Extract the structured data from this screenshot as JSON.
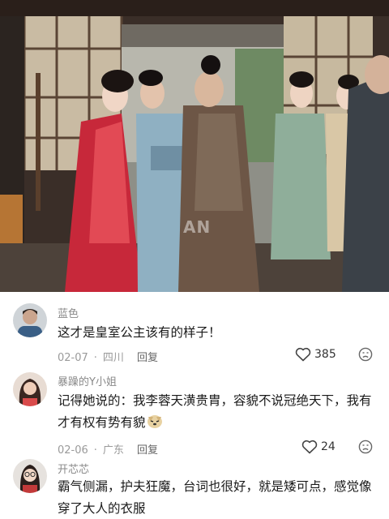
{
  "watermark": "AN",
  "comments": [
    {
      "user": "蓝色",
      "text": "这才是皇室公主该有的样子！",
      "date": "02-07",
      "location": "四川",
      "reply_label": "回复",
      "likes": "385"
    },
    {
      "user": "暴躁的Y小姐",
      "text": "记得她说的：我李蓉天潢贵胄，容貌不说冠绝天下，我有才有权有势有貌",
      "date": "02-06",
      "location": "广东",
      "reply_label": "回复",
      "likes": "24"
    },
    {
      "user": "开芯芯",
      "text": "霸气侧漏，护夫狂魔，台词也很好，就是矮可点，感觉像穿了大人的衣服"
    }
  ],
  "icons": {
    "like": "heart-outline-icon",
    "dislike": "dislike-face-icon",
    "inline_emoji": "doge-emoji-icon"
  },
  "colors": {
    "username": "#8a8a8a",
    "meta": "#9a9a9a",
    "text": "#1a1a1a"
  }
}
